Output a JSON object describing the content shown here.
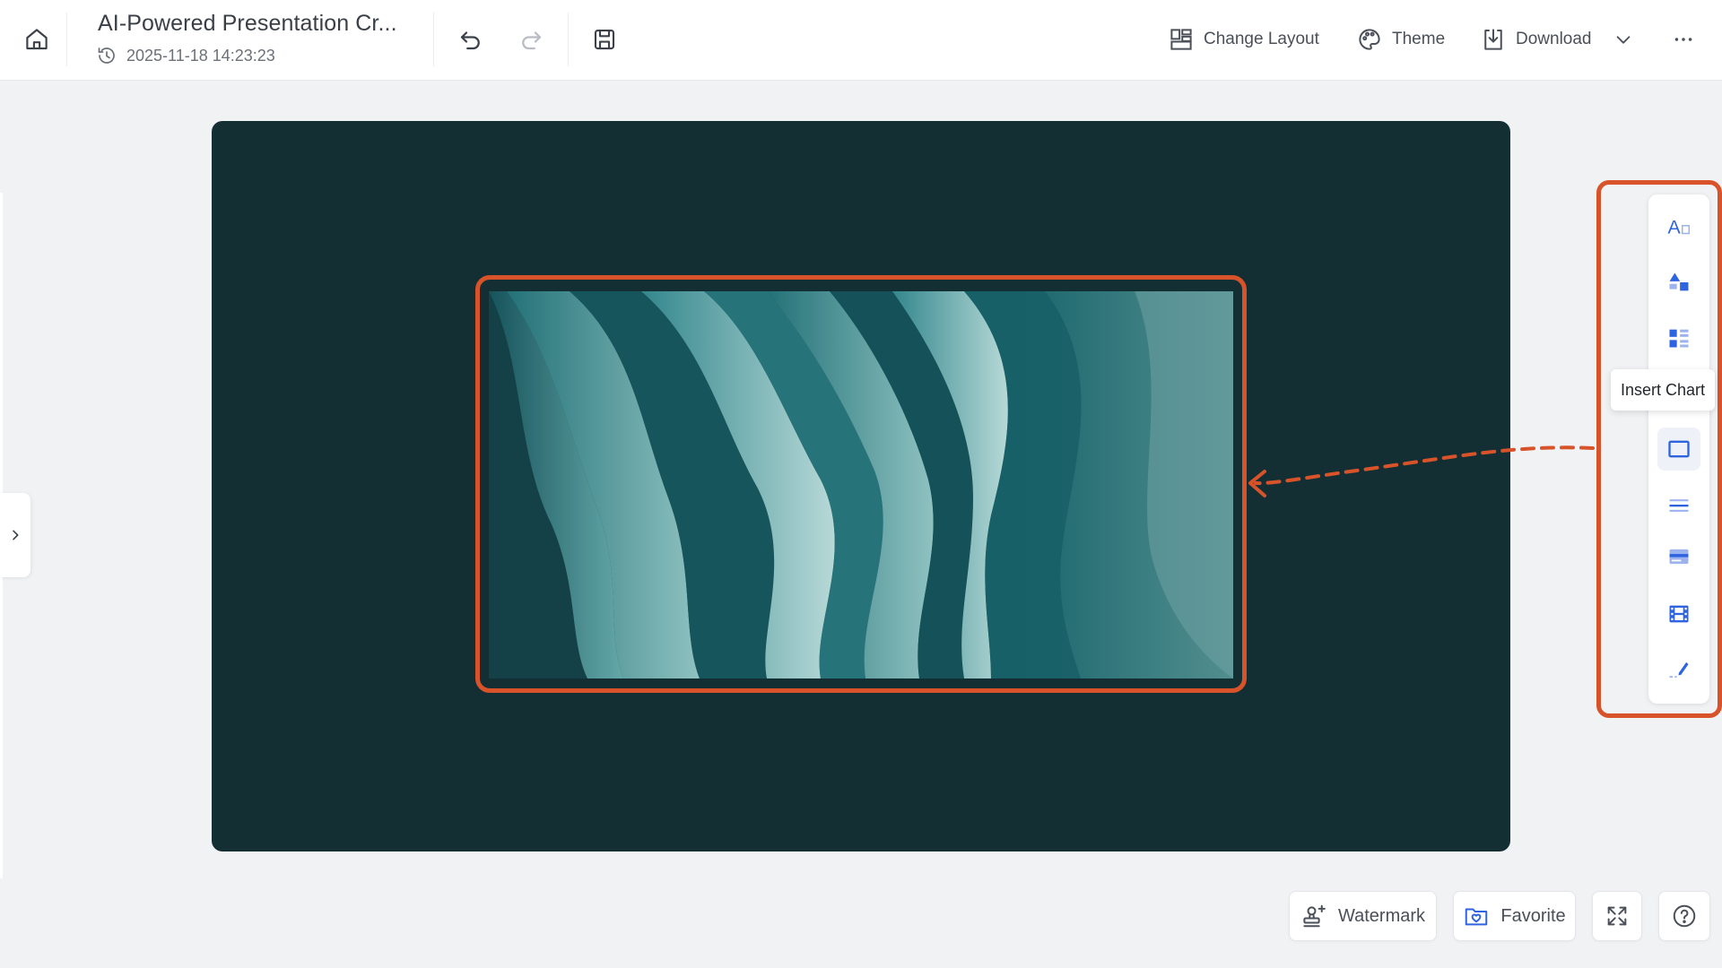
{
  "header": {
    "doc_title": "AI-Powered Presentation Cr...",
    "timestamp": "2025-11-18 14:23:23",
    "actions": {
      "change_layout": "Change Layout",
      "theme": "Theme",
      "download": "Download"
    },
    "icons": {
      "home": "home-icon",
      "history": "clock-history-icon",
      "undo": "undo-icon",
      "redo": "redo-icon",
      "save": "save-icon",
      "layout": "layout-icon",
      "theme": "palette-icon",
      "download": "download-icon",
      "chevron": "chevron-down-icon",
      "more": "more-horizontal-icon"
    }
  },
  "toolbar_right": {
    "tooltip": "Insert Chart",
    "tools": [
      "text-tool",
      "shape-tool",
      "chart-tool",
      "image-frame-tool",
      "line-tool",
      "banner-tool",
      "video-tool",
      "draw-tool"
    ],
    "active_tool": "image-frame-tool"
  },
  "bottom": {
    "watermark": "Watermark",
    "favorite": "Favorite"
  },
  "colors": {
    "accent": "#2f64e0",
    "highlight": "#d9532a",
    "slide_bg": "#132f34"
  }
}
